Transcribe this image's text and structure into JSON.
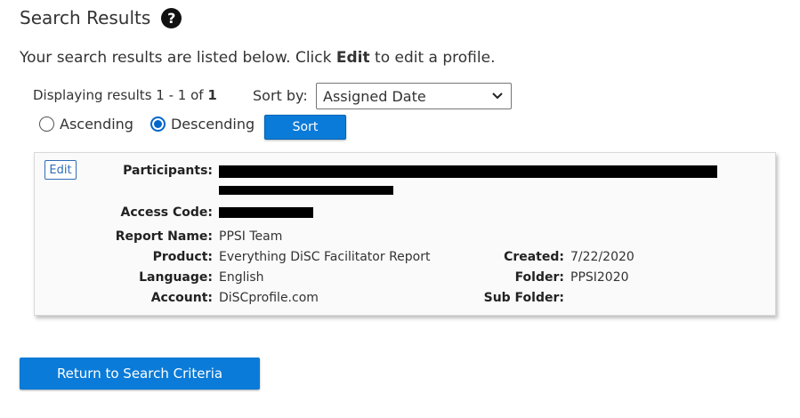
{
  "header": {
    "title": "Search Results",
    "help_icon": "question-circle-icon"
  },
  "intro": {
    "before": "Your search results are listed below. Click ",
    "bold": "Edit",
    "after": " to edit a profile."
  },
  "results": {
    "prefix": "Displaying results 1 - 1 of ",
    "total": "1"
  },
  "sort": {
    "label": "Sort by:",
    "selected": "Assigned Date",
    "ascending_label": "Ascending",
    "descending_label": "Descending",
    "order": "descending",
    "button_label": "Sort"
  },
  "profile": {
    "edit_label": "Edit",
    "participants_label": "Participants:",
    "access_code_label": "Access Code:",
    "report_name_label": "Report Name:",
    "report_name": "PPSI Team",
    "product_label": "Product:",
    "product": "Everything DiSC Facilitator Report",
    "language_label": "Language:",
    "language": "English",
    "account_label": "Account:",
    "account": "DiSCprofile.com",
    "created_label": "Created:",
    "created": "7/22/2020",
    "folder_label": "Folder:",
    "folder": "PPSI2020",
    "sub_folder_label": "Sub Folder:",
    "sub_folder": ""
  },
  "footer": {
    "return_label": "Return to Search Criteria"
  },
  "colors": {
    "primary_button": "#0a7bd8",
    "link_blue": "#2f6db8",
    "radio_blue": "#0066cc"
  }
}
